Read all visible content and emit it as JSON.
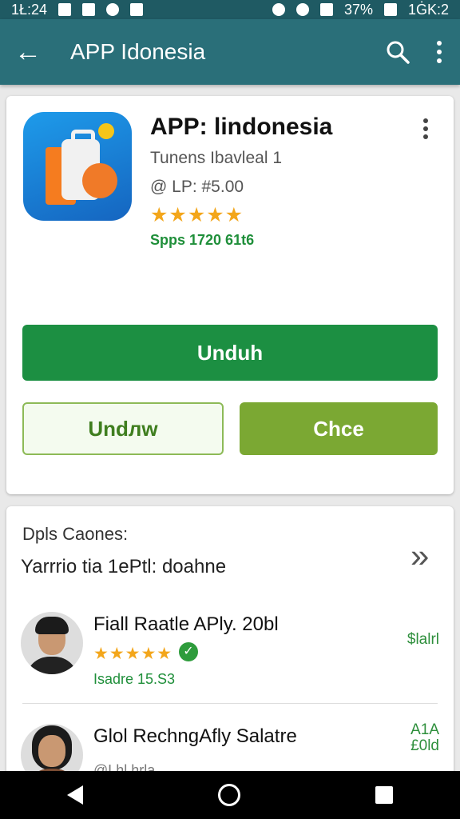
{
  "status_bar": {
    "time": "1Ł:24",
    "battery": "37%",
    "clock": "1ĠK:2"
  },
  "app_bar": {
    "back_label": "←",
    "title": "APP Idonesia"
  },
  "app": {
    "title": "APP: lindonesia",
    "developer": "Tunens Ibavleal 1",
    "price": "@ LP: #5.00",
    "rating_stars_full": "★★★★★",
    "rating_stars_half": "★",
    "rating": 4.5,
    "downloads": "Spps 1720 61t6",
    "icon": "app-bag-icon"
  },
  "actions": {
    "primary": "Unduh",
    "secondary": "Undлw",
    "tertiary": "Chce"
  },
  "reviews": {
    "title": "Dpls Caones:",
    "subtitle": "Yarrrio tia 1ePtl: doahne",
    "items": [
      {
        "name": "Fiall Raatle APly. 20bl",
        "stars": "★★★★★",
        "meta": "Isadre 15.S3",
        "tag": "$lalrl",
        "verified": "✓"
      },
      {
        "name": "Glol RechngAfly Salatre",
        "meta": "@Lhl hrla",
        "tag": "A1A\n£0ld"
      }
    ]
  },
  "colors": {
    "appbar": "#2a6f79",
    "primary": "#1c8f42",
    "lime": "#7ba833",
    "star": "#f3a61b"
  }
}
